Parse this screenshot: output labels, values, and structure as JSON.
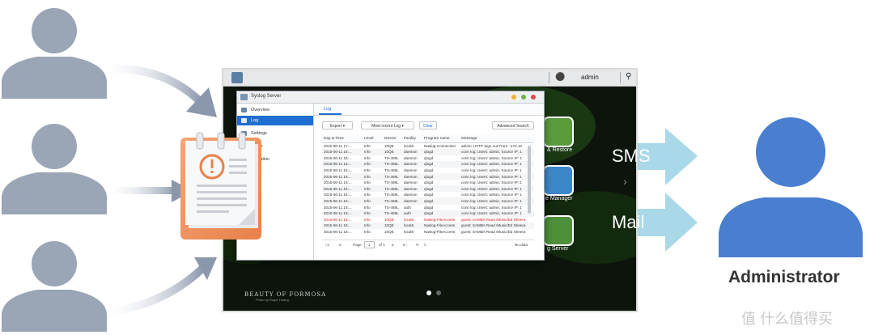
{
  "desktop": {
    "username": "admin",
    "icons": [
      {
        "name": "backup-restore",
        "label": "& Restore",
        "color": "#66b04a"
      },
      {
        "name": "manager",
        "label": "e Manager",
        "color": "#3d86c8"
      },
      {
        "name": "syslog-server",
        "label": "g Server",
        "color": "#4d8f3a"
      }
    ],
    "brand": "BEAUTY OF FORMOSA",
    "brand_sub": "Photo by Roger Huang"
  },
  "window": {
    "title": "Syslog Server",
    "sidebar": [
      {
        "label": "Overview",
        "active": false
      },
      {
        "label": "Log",
        "active": true
      },
      {
        "label": "Settings",
        "active": false
      },
      {
        "label": "rchive",
        "active": false
      },
      {
        "label": "otification",
        "active": false
      },
      {
        "label": "istory",
        "active": false
      }
    ],
    "tab": "Log",
    "toolbar": {
      "export": "Export",
      "recent": "Most recent Log",
      "clear": "Clear",
      "advanced": "Advanced Search"
    },
    "columns": [
      "Day & Time",
      "Level",
      "Device",
      "Facility",
      "Program name",
      "Message"
    ],
    "rows": [
      [
        "2015-06-11 17:...",
        "Info",
        "10QE",
        "local6",
        "Naslog-Connection",
        "admin: HTTP Sign out From ::172.16"
      ],
      [
        "2015-06-11 16:...",
        "Info",
        "10QE",
        "daemon",
        "qlogd",
        "conn log: Users: admin, Source IP: 1"
      ],
      [
        "2015-06-11 16:...",
        "Info",
        "TS-469L",
        "daemon",
        "qlogd",
        "conn log: Users: admin, Source IP: 1"
      ],
      [
        "2015-06-11 16:...",
        "Info",
        "TS-469L",
        "daemon",
        "qlogd",
        "conn log: Users: admin, Source IP: 1"
      ],
      [
        "2015-06-11 16:...",
        "Info",
        "TS-469L",
        "daemon",
        "qlogd",
        "conn log: Users: admin, Source IP: 1"
      ],
      [
        "2015-06-11 16:...",
        "Info",
        "TS-469L",
        "daemon",
        "qlogd",
        "conn log: Users: admin, Source IP: 1"
      ],
      [
        "2015-06-11 16:...",
        "Info",
        "TS-469L",
        "daemon",
        "qlogd",
        "conn log: Users: admin, Source IP: 1"
      ],
      [
        "2015-06-11 16:...",
        "Info",
        "TS-469L",
        "daemon",
        "qlogd",
        "conn log: Users: admin, Source IP: 1"
      ],
      [
        "2015-06-11 16:...",
        "Info",
        "TS-469L",
        "daemon",
        "qlogd",
        "conn log: Users: admin, Source IP: 1"
      ],
      [
        "2015-06-11 16:...",
        "Info",
        "TS-469L",
        "daemon",
        "qlogd",
        "conn log: Users: admin, Source IP: 1"
      ],
      [
        "2015-06-11 16:...",
        "Info",
        "TS-469L",
        "auth",
        "qlogd",
        "conn log: Users: admin, Source IP: 1"
      ],
      [
        "2015-06-11 16:...",
        "Info",
        "TS-469L",
        "auth",
        "qlogd",
        "conn log: Users: admin, Source IP: 1"
      ],
      [
        "2015-06-11 16:...",
        "Info",
        "10QE",
        "local6",
        "Naslog-FileAccess",
        "guest: SAMBA Read /Music/Ed Sheera"
      ],
      [
        "2015-06-11 16:...",
        "Info",
        "10QE",
        "local6",
        "Naslog-FileAccess",
        "guest: SAMBA Read /Music/Ed Sheera"
      ],
      [
        "2015-06-11 16:...",
        "Info",
        "10QE",
        "local6",
        "Naslog-FileAccess",
        "guest: SAMBA Read /Music/Ed Sheera"
      ]
    ],
    "error_rows": [
      12
    ],
    "pager": {
      "page_label": "Page",
      "page": "1",
      "of": "of 1",
      "status": "No data"
    }
  },
  "notifications": {
    "sms": "SMS",
    "mail": "Mail"
  },
  "admin_label": "Administrator",
  "watermark": "值 什么值得买",
  "colors": {
    "user_gray": "#9aa5b5",
    "admin_blue": "#4a7fcf",
    "arrow_cyan": "#a8d8e8",
    "accent": "#1f6fd0"
  }
}
